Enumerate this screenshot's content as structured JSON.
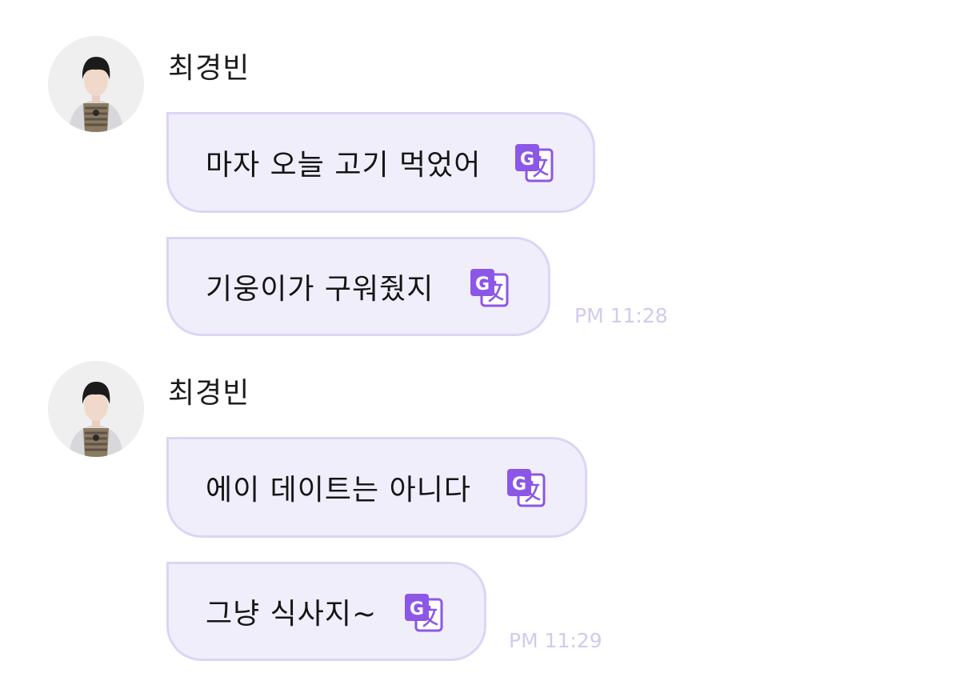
{
  "groups": [
    {
      "sender": "최경빈",
      "messages": [
        "마자 오늘 고기 먹었어",
        "기웅이가 구워줬지"
      ],
      "time": "PM 11:28"
    },
    {
      "sender": "최경빈",
      "messages": [
        "에이 데이트는 아니다",
        "그냥 식사지~"
      ],
      "time": "PM 11:29"
    }
  ],
  "icons": {
    "translate": "google-translate-icon",
    "avatar": "profile-photo"
  },
  "colors": {
    "bubble_bg": "#f1eefb",
    "bubble_border": "#ddd4f5",
    "translate_purple": "#8c57e6",
    "time_text": "#d3caed"
  }
}
